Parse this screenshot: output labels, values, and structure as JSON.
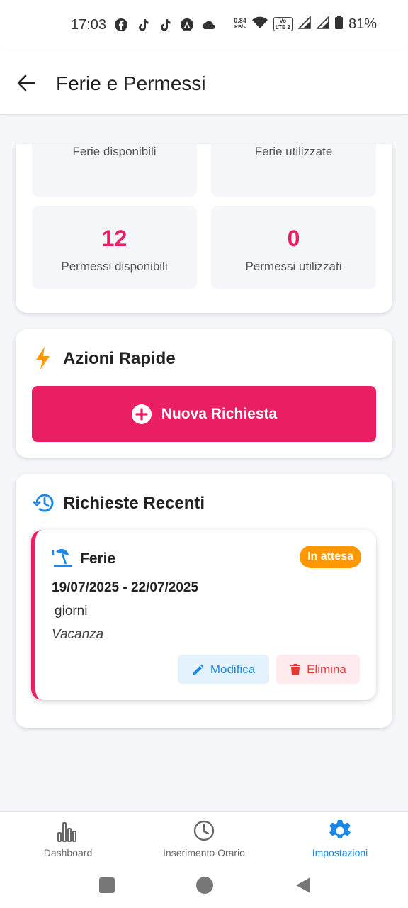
{
  "status_bar": {
    "time": "17:03",
    "net_speed_value": "0.84",
    "net_speed_unit": "KB/s",
    "volte_top": "Vo",
    "volte_bottom": "LTE 2",
    "battery": "81%"
  },
  "app_bar": {
    "title": "Ferie e Permessi"
  },
  "stats": {
    "ferie_disponibili_label": "Ferie disponibili",
    "ferie_utilizzate_label": "Ferie utilizzate",
    "permessi_disponibili_value": "12",
    "permessi_disponibili_label": "Permessi disponibili",
    "permessi_utilizzati_value": "0",
    "permessi_utilizzati_label": "Permessi utilizzati"
  },
  "quick_actions": {
    "title": "Azioni Rapide",
    "new_request_label": "Nuova Richiesta"
  },
  "recent_requests": {
    "title": "Richieste Recenti",
    "items": [
      {
        "type": "Ferie",
        "status": "In attesa",
        "dates": "19/07/2025 - 22/07/2025",
        "days": "giorni",
        "note": "Vacanza",
        "edit_label": "Modifica",
        "delete_label": "Elimina"
      }
    ]
  },
  "bottom_nav": {
    "items": [
      {
        "label": "Dashboard",
        "icon": "bar-chart-icon",
        "active": false
      },
      {
        "label": "Inserimento Orario",
        "icon": "clock-icon",
        "active": false
      },
      {
        "label": "Impostazioni",
        "icon": "gear-icon",
        "active": true
      }
    ]
  },
  "colors": {
    "accent": "#e91e63",
    "pending": "#ff9800",
    "edit": "#1e88e5",
    "delete": "#e53935"
  }
}
